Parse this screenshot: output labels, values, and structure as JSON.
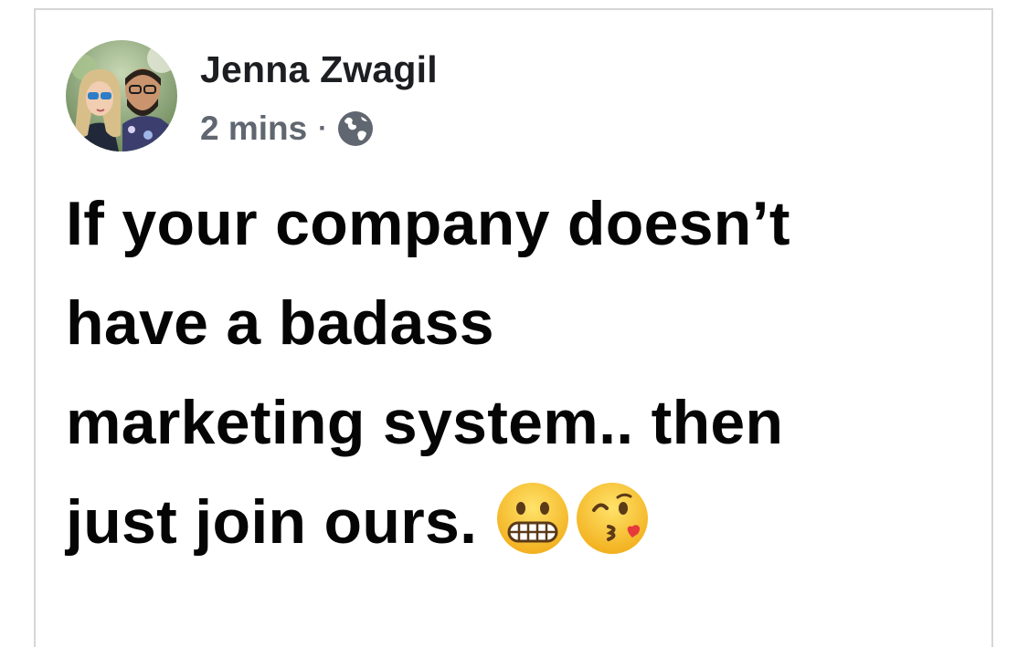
{
  "post": {
    "author": "Jenna Zwagil",
    "timestamp": "2 mins",
    "separator": "·",
    "privacy_icon": "globe-icon",
    "text_lines": [
      "If your company doesn’t",
      "have a badass",
      "marketing system.. then",
      "just join ours."
    ],
    "emojis": [
      "grimacing-face-emoji",
      "face-blowing-kiss-emoji"
    ]
  },
  "colors": {
    "author": "#1c1e21",
    "meta": "#606770",
    "text": "#050505",
    "border": "#d6d6d6",
    "emoji_yellow": "#f8c72e"
  }
}
